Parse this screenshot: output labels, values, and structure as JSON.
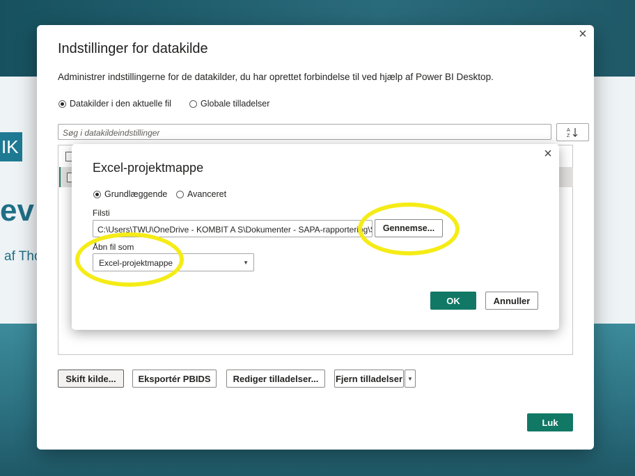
{
  "background_app": {
    "logo_text": "IK",
    "big_word": "ev",
    "byline": "af Tho"
  },
  "dialog": {
    "title": "Indstillinger for datakilde",
    "description": "Administrer indstillingerne for de datakilder, du har oprettet forbindelse til ved hjælp af Power BI Desktop.",
    "scope_options": [
      {
        "label": "Datakilder i den aktuelle fil",
        "selected": true
      },
      {
        "label": "Globale tilladelser",
        "selected": false
      }
    ],
    "search": {
      "placeholder": "Søg i datakildeindstillinger",
      "value": ""
    },
    "sort_icon": "sort-az-icon",
    "buttons": {
      "change_source": "Skift kilde...",
      "export_pbids": "Eksportér PBIDS",
      "edit_permissions": "Rediger tilladelser...",
      "remove_permissions": "Fjern tilladelser",
      "close": "Luk"
    }
  },
  "inner_dialog": {
    "title": "Excel-projektmappe",
    "mode_options": [
      {
        "label": "Grundlæggende",
        "selected": true
      },
      {
        "label": "Avanceret",
        "selected": false
      }
    ],
    "file_path": {
      "label": "Filsti",
      "value": "C:\\Users\\TWU\\OneDrive - KOMBIT A S\\Dokumenter - SAPA-rapportering\\S"
    },
    "browse_button": "Gennemse...",
    "open_as": {
      "label": "Åbn fil som",
      "selected": "Excel-projektmappe"
    },
    "ok_button": "OK",
    "cancel_button": "Annuller"
  },
  "colors": {
    "primary": "#117865",
    "highlight": "#f5ec17",
    "background_app": "#2d7385"
  }
}
